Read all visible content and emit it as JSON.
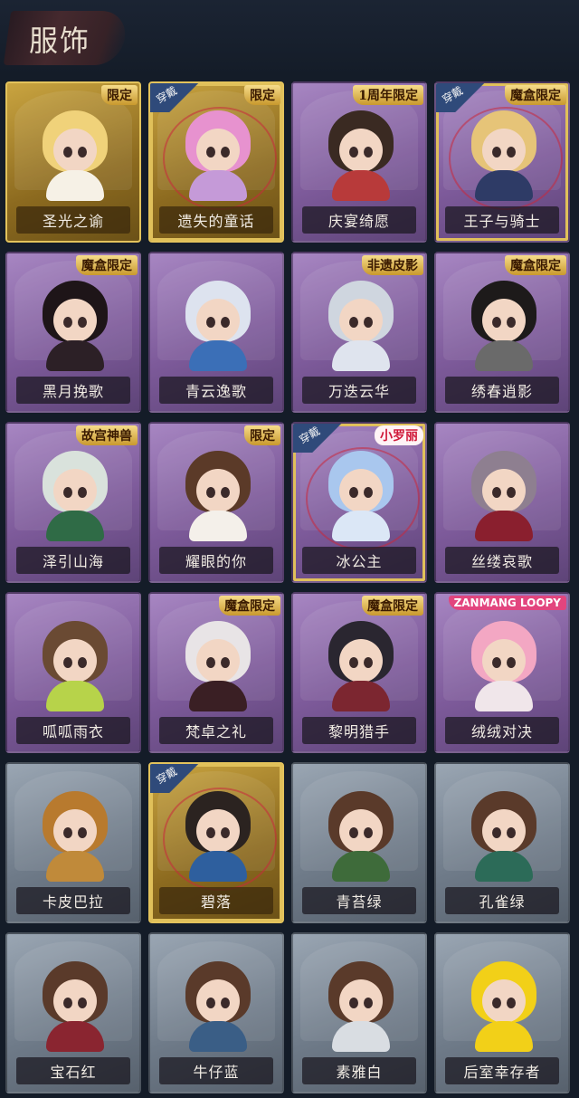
{
  "header": {
    "title": "服饰"
  },
  "cards": [
    {
      "name": "圣光之谕",
      "tier": "gold",
      "badge": "限定",
      "badge_style": "gold",
      "worn": false,
      "hair": "#f0d27a",
      "outfit": "#f6f1e6"
    },
    {
      "name": "遗失的童话",
      "tier": "gold",
      "badge": "限定",
      "badge_style": "gold",
      "worn": true,
      "hair": "#e792cf",
      "outfit": "#c59ad8"
    },
    {
      "name": "庆宴绮愿",
      "tier": "purple",
      "badge": "1周年限定",
      "badge_style": "gold",
      "worn": false,
      "hair": "#3a2a22",
      "outfit": "#b83a3a"
    },
    {
      "name": "王子与骑士",
      "tier": "purple",
      "badge": "魔盒限定",
      "badge_style": "gold",
      "worn": true,
      "hair": "#e6c478",
      "outfit": "#2e3b66"
    },
    {
      "name": "黑月挽歌",
      "tier": "purple",
      "badge": "魔盒限定",
      "badge_style": "gold",
      "worn": false,
      "hair": "#1e1518",
      "outfit": "#2c2026"
    },
    {
      "name": "青云逸歌",
      "tier": "purple",
      "badge": "",
      "badge_style": "gold",
      "worn": false,
      "hair": "#dde3ef",
      "outfit": "#3b6fb7"
    },
    {
      "name": "万迭云华",
      "tier": "purple",
      "badge": "非遗皮影",
      "badge_style": "gold",
      "worn": false,
      "hair": "#cfd6df",
      "outfit": "#dfe4ee"
    },
    {
      "name": "绣春逍影",
      "tier": "purple",
      "badge": "魔盒限定",
      "badge_style": "gold",
      "worn": false,
      "hair": "#1d1a1a",
      "outfit": "#6a6a6a"
    },
    {
      "name": "泽引山海",
      "tier": "purple",
      "badge": "故宫神兽",
      "badge_style": "gold",
      "worn": false,
      "hair": "#d9e2dc",
      "outfit": "#2f6b46"
    },
    {
      "name": "耀眼的你",
      "tier": "purple",
      "badge": "限定",
      "badge_style": "gold",
      "worn": false,
      "hair": "#5b3a28",
      "outfit": "#f4f0ea"
    },
    {
      "name": "冰公主",
      "tier": "purple",
      "badge": "小罗丽",
      "badge_style": "red",
      "worn": true,
      "hair": "#a9c7ee",
      "outfit": "#dbe7f6"
    },
    {
      "name": "丝缕哀歌",
      "tier": "purple",
      "badge": "",
      "badge_style": "gold",
      "worn": false,
      "hair": "#8e7f90",
      "outfit": "#8a1f2e"
    },
    {
      "name": "呱呱雨衣",
      "tier": "purple",
      "badge": "",
      "badge_style": "gold",
      "worn": false,
      "hair": "#6a4a33",
      "outfit": "#b7d34a"
    },
    {
      "name": "梵卓之礼",
      "tier": "purple",
      "badge": "魔盒限定",
      "badge_style": "gold",
      "worn": false,
      "hair": "#e8e4e6",
      "outfit": "#3a1f24"
    },
    {
      "name": "黎明猎手",
      "tier": "purple",
      "badge": "魔盒限定",
      "badge_style": "gold",
      "worn": false,
      "hair": "#2a2630",
      "outfit": "#7c2630"
    },
    {
      "name": "绒绒对决",
      "tier": "purple",
      "badge": "ZANMANG LOOPY",
      "badge_style": "brand",
      "worn": false,
      "hair": "#f3a7c3",
      "outfit": "#f0e6ea"
    },
    {
      "name": "卡皮巴拉",
      "tier": "gray",
      "badge": "",
      "badge_style": "gold",
      "worn": false,
      "hair": "#b87a2e",
      "outfit": "#c08a3a"
    },
    {
      "name": "碧落",
      "tier": "gold",
      "badge": "",
      "badge_style": "gold",
      "worn": true,
      "hair": "#2b2320",
      "outfit": "#2e5f9e"
    },
    {
      "name": "青苔绿",
      "tier": "gray",
      "badge": "",
      "badge_style": "gold",
      "worn": false,
      "hair": "#5a3a2a",
      "outfit": "#3e6b3a"
    },
    {
      "name": "孔雀绿",
      "tier": "gray",
      "badge": "",
      "badge_style": "gold",
      "worn": false,
      "hair": "#5a3a2a",
      "outfit": "#2c6b58"
    },
    {
      "name": "宝石红",
      "tier": "gray",
      "badge": "",
      "badge_style": "gold",
      "worn": false,
      "hair": "#5a3a2a",
      "outfit": "#8a2530"
    },
    {
      "name": "牛仔蓝",
      "tier": "gray",
      "badge": "",
      "badge_style": "gold",
      "worn": false,
      "hair": "#5a3a2a",
      "outfit": "#3a5e86"
    },
    {
      "name": "素雅白",
      "tier": "gray",
      "badge": "",
      "badge_style": "gold",
      "worn": false,
      "hair": "#5a3a2a",
      "outfit": "#d9dde2"
    },
    {
      "name": "后室幸存者",
      "tier": "gray",
      "badge": "",
      "badge_style": "gold",
      "worn": false,
      "hair": "#f2d018",
      "outfit": "#f2d018"
    }
  ],
  "wear_label": "穿戴",
  "colors": {
    "background": "#141c28",
    "gold_frame": "#e3c35c",
    "label_text": "#f1ece4"
  }
}
